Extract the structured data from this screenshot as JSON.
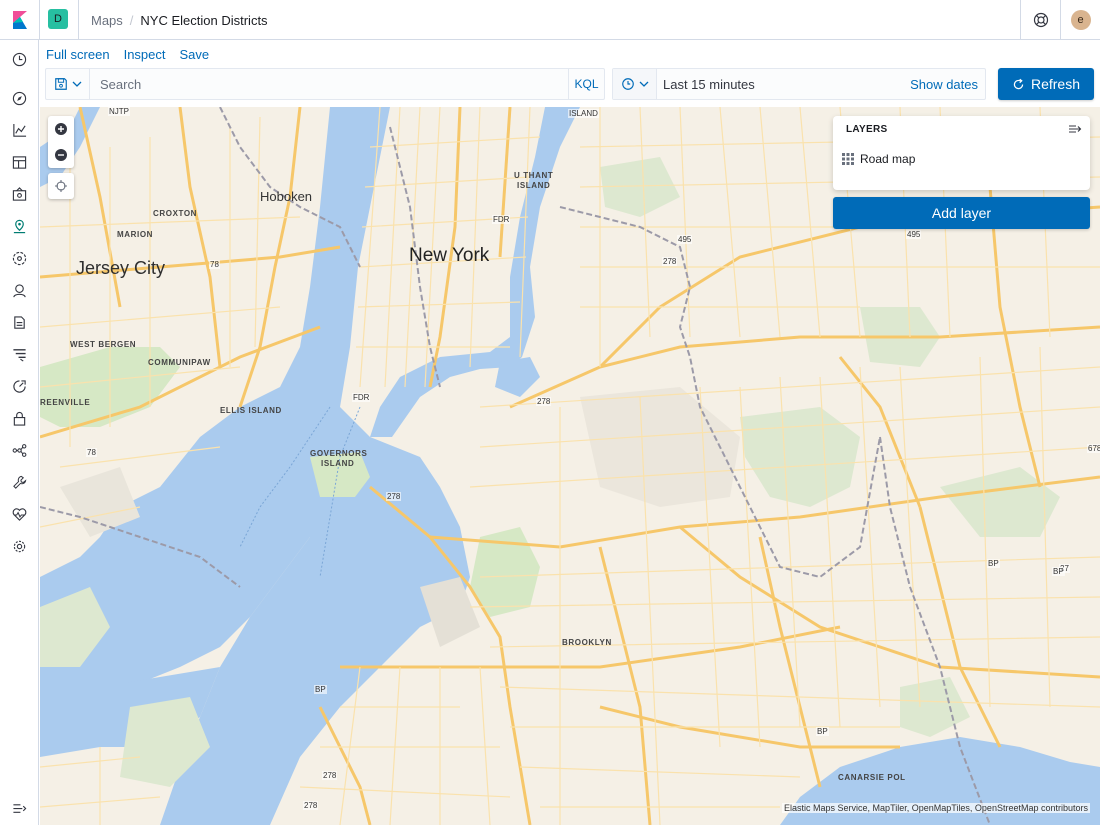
{
  "header": {
    "space_initial": "D",
    "breadcrumb_parent": "Maps",
    "breadcrumb_current": "NYC Election Districts",
    "avatar_initial": "e"
  },
  "toolbar": {
    "full_screen": "Full screen",
    "inspect": "Inspect",
    "save": "Save"
  },
  "query": {
    "placeholder": "Search",
    "language": "KQL"
  },
  "time": {
    "range": "Last 15 minutes",
    "show_dates": "Show dates",
    "refresh": "Refresh"
  },
  "layers": {
    "title": "LAYERS",
    "items": [
      {
        "label": "Road map"
      }
    ],
    "add_label": "Add layer"
  },
  "map": {
    "labels": {
      "hoboken": "Hoboken",
      "jersey_city": "Jersey City",
      "new_york": "New York",
      "njtp": "NJTP",
      "croxton": "CROXTON",
      "marion": "MARION",
      "west_bergen": "WEST BERGEN",
      "communipaw": "COMMUNIPAW",
      "greenville": "REENVILLE",
      "ellis_island": "ELLIS ISLAND",
      "governors_island_1": "GOVERNORS",
      "governors_island_2": "ISLAND",
      "u_thant_1": "U THANT",
      "u_thant_2": "ISLAND",
      "island_top": "ISLAND",
      "brooklyn": "BROOKLYN",
      "canarsie_pol": "CANARSIE POL",
      "shield_78_a": "78",
      "shield_78_b": "78",
      "shield_fdr_a": "FDR",
      "shield_fdr_b": "FDR",
      "shield_495_a": "495",
      "shield_495_b": "495",
      "shield_278_a": "278",
      "shield_278_b": "278",
      "shield_278_c": "278",
      "shield_278_d": "278",
      "shield_278_e": "278",
      "shield_bp_a": "BP",
      "shield_bp_b": "BP",
      "shield_bp_c": "BP",
      "shield_bp_d": "BP",
      "shield_27": "27",
      "shield_678": "678"
    },
    "attribution": "Elastic Maps Service, MapTiler, OpenMapTiles, OpenStreetMap contributors"
  },
  "colors": {
    "accent": "#006bb8",
    "water": "#aacbee",
    "land": "#f5f0e6",
    "park": "#d6e8c5",
    "road": "#f9d27e"
  }
}
